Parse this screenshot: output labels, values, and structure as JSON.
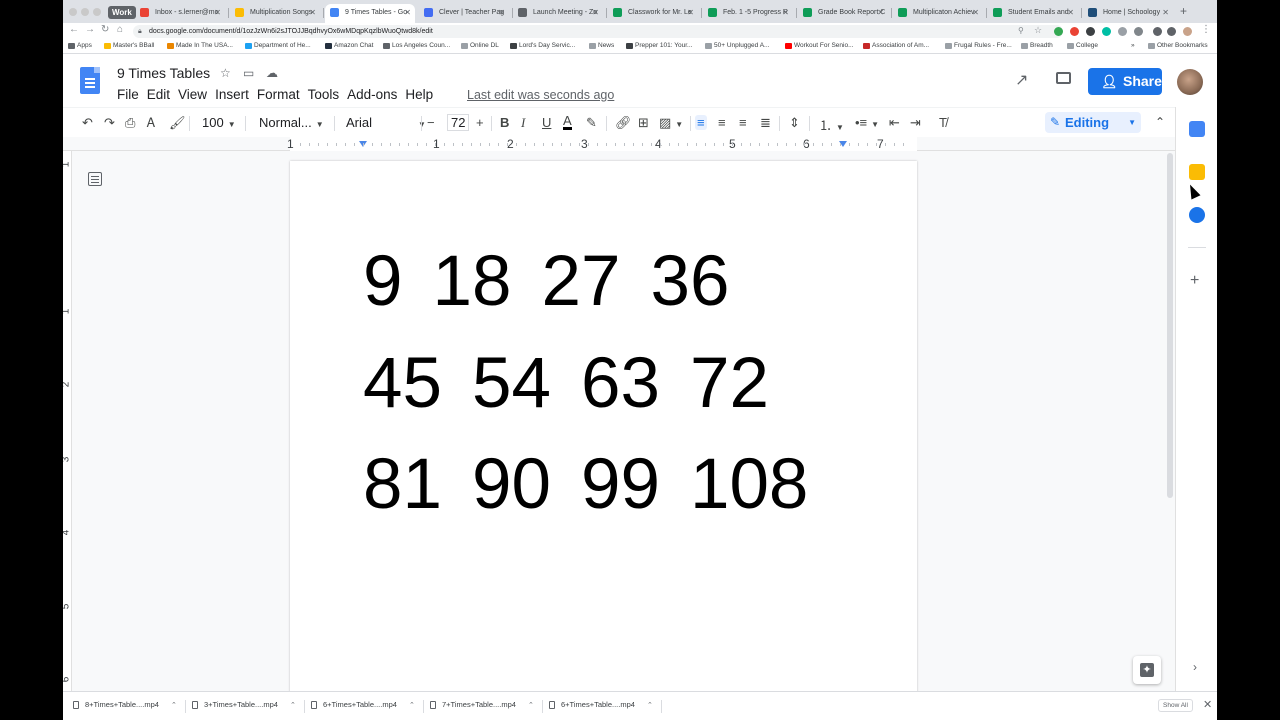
{
  "browser": {
    "tab_group_label": "Work",
    "tabs": [
      {
        "label": "Inbox - s.lerner@mc",
        "favicon": "gmail-icon",
        "color": "#ea4335"
      },
      {
        "label": "Multiplication Songs",
        "favicon": "drive-icon",
        "color": "#fbbc04"
      },
      {
        "label": "9 Times Tables - Go",
        "favicon": "docs-icon",
        "color": "#4285f4",
        "active": true
      },
      {
        "label": "Clever | Teacher Pag",
        "favicon": "clever-icon",
        "color": "#436cf2"
      },
      {
        "label": "Launch Meeting - Zo",
        "favicon": "zoom-icon",
        "color": "#5f6368"
      },
      {
        "label": "Classwork for Mr. Le",
        "favicon": "classroom-icon",
        "color": "#0f9d58"
      },
      {
        "label": "Feb. 1 -5 Progress R",
        "favicon": "sheets-icon",
        "color": "#0f9d58"
      },
      {
        "label": "Grade Book Report C",
        "favicon": "sheets-icon",
        "color": "#0f9d58"
      },
      {
        "label": "Multiplicaton Achiev",
        "favicon": "sheets-icon",
        "color": "#0f9d58"
      },
      {
        "label": "Student Emails and",
        "favicon": "sheets-icon",
        "color": "#0f9d58"
      },
      {
        "label": "Home | Schoology",
        "favicon": "schoology-icon",
        "color": "#1f4e79"
      }
    ],
    "url": "docs.google.com/document/d/1ozJzWn6i2sJTOJJBqdhvyOx6wMDqpKqzlbWuoQtwd8k/edit",
    "bookmarks": [
      {
        "label": "Apps",
        "color": "#5f6368"
      },
      {
        "label": "Master's BBall",
        "color": "#fbbc04"
      },
      {
        "label": "Made In The USA...",
        "color": "#ea8600"
      },
      {
        "label": "Department of He...",
        "color": "#1da1f2"
      },
      {
        "label": "Amazon Chat",
        "color": "#232f3e"
      },
      {
        "label": "Los Angeles Coun...",
        "color": "#5f6368"
      },
      {
        "label": "Online DL",
        "color": "#9aa0a6"
      },
      {
        "label": "Lord's Day Servic...",
        "color": "#3c4043"
      },
      {
        "label": "News",
        "color": "#9aa0a6"
      },
      {
        "label": "Prepper 101: Your...",
        "color": "#3c4043"
      },
      {
        "label": "50+ Unplugged A...",
        "color": "#9aa0a6"
      },
      {
        "label": "Workout For Senio...",
        "color": "#ff0000"
      },
      {
        "label": "Association of Am...",
        "color": "#c62828"
      },
      {
        "label": "Frugal Rules - Fre...",
        "color": "#9aa0a6"
      },
      {
        "label": "Breadth",
        "color": "#9aa0a6"
      },
      {
        "label": "College",
        "color": "#9aa0a6"
      }
    ],
    "other_bookmarks": "Other Bookmarks"
  },
  "docs": {
    "title": "9 Times Tables",
    "menu": [
      "File",
      "Edit",
      "View",
      "Insert",
      "Format",
      "Tools",
      "Add-ons",
      "Help"
    ],
    "last_edit": "Last edit was seconds ago",
    "share_label": "Share",
    "toolbar": {
      "zoom": "100",
      "style": "Normal...",
      "font": "Arial",
      "font_size": "72",
      "minus": "−",
      "plus": "+",
      "editing_mode": "Editing"
    },
    "ruler_numbers": [
      "1",
      "1",
      "2",
      "3",
      "4",
      "5",
      "6",
      "7"
    ],
    "vruler_numbers": [
      "1",
      "1",
      "2",
      "3",
      "4",
      "5",
      "6"
    ],
    "content_rows": [
      [
        "9",
        "18",
        "27",
        "36"
      ],
      [
        "45",
        "54",
        "63",
        "72"
      ],
      [
        "81",
        "90",
        "99",
        "108"
      ]
    ]
  },
  "downloads": {
    "items": [
      "8+Times+Table....mp4",
      "3+Times+Table....mp4",
      "6+Times+Table....mp4",
      "7+Times+Table....mp4",
      "6+Times+Table....mp4"
    ],
    "show_all": "Show All"
  },
  "colors": {
    "accent": "#1a73e8",
    "docs_blue": "#4285f4"
  }
}
